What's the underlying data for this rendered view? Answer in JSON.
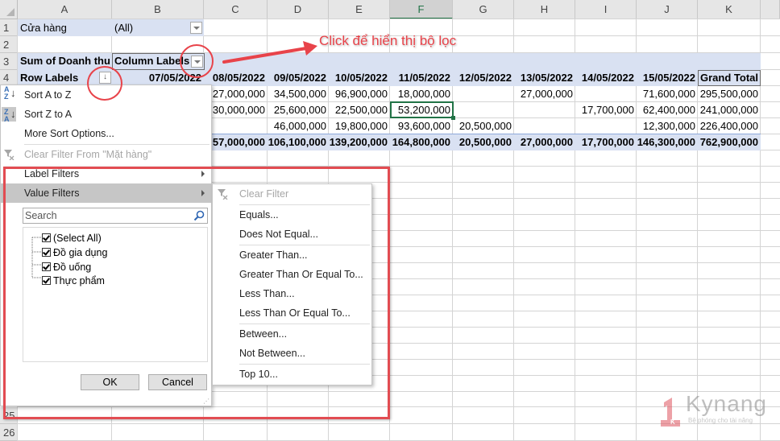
{
  "sheet": {
    "columns": [
      "A",
      "B",
      "C",
      "D",
      "E",
      "F",
      "G",
      "H",
      "I",
      "J",
      "K"
    ],
    "selected_column": "F",
    "rows_visible": [
      "1",
      "2",
      "3",
      "4",
      "25",
      "26"
    ]
  },
  "pivot": {
    "filter_label": "Cửa hàng",
    "filter_value": "(All)",
    "value_field": "Sum of Doanh thu",
    "column_labels": "Column Labels",
    "row_labels": "Row Labels",
    "date_headers": [
      "07/05/2022",
      "08/05/2022",
      "09/05/2022",
      "10/05/2022",
      "11/05/2022",
      "12/05/2022",
      "13/05/2022",
      "14/05/2022",
      "15/05/2022"
    ],
    "grand_total_header": "Grand Total",
    "rows": [
      {
        "values": [
          "",
          "27,000,000",
          "34,500,000",
          "96,900,000",
          "18,000,000",
          "",
          "27,000,000",
          "",
          "71,600,000"
        ],
        "total": "295,500,000"
      },
      {
        "values": [
          "",
          "30,000,000",
          "25,600,000",
          "22,500,000",
          "53,200,000",
          "",
          "",
          "17,700,000",
          "62,400,000"
        ],
        "total": "241,000,000"
      },
      {
        "values": [
          "",
          "",
          "46,000,000",
          "19,800,000",
          "93,600,000",
          "20,500,000",
          "",
          "",
          "12,300,000"
        ],
        "total": "226,400,000"
      }
    ],
    "grand_total_row": {
      "values": [
        "",
        "57,000,000",
        "106,100,000",
        "139,200,000",
        "164,800,000",
        "20,500,000",
        "27,000,000",
        "17,700,000",
        "146,300,000"
      ],
      "total": "762,900,000"
    },
    "active_cell": "53,200,000"
  },
  "filter_menu": {
    "items": [
      {
        "label": "Sort A to Z",
        "icon": "sort-az-icon",
        "disabled": false
      },
      {
        "label": "Sort Z to A",
        "icon": "sort-za-icon",
        "disabled": false
      },
      {
        "label": "More Sort Options...",
        "disabled": false
      },
      {
        "label": "Clear Filter From \"Mặt hàng\"",
        "icon": "clear-filter-icon",
        "disabled": true
      },
      {
        "label": "Label Filters",
        "submenu": true
      },
      {
        "label": "Value Filters",
        "submenu": true,
        "highlighted": true
      }
    ],
    "search_placeholder": "Search",
    "list": [
      {
        "label": "(Select All)",
        "checked": true
      },
      {
        "label": "Đồ gia dụng",
        "checked": true
      },
      {
        "label": "Đồ uống",
        "checked": true
      },
      {
        "label": "Thực phẩm",
        "checked": true
      }
    ],
    "ok_label": "OK",
    "cancel_label": "Cancel"
  },
  "value_filters_submenu": {
    "items": [
      {
        "label": "Clear Filter",
        "disabled": true
      },
      {
        "label": "Equals..."
      },
      {
        "label": "Does Not Equal..."
      },
      {
        "label": "Greater Than..."
      },
      {
        "label": "Greater Than Or Equal To..."
      },
      {
        "label": "Less Than..."
      },
      {
        "label": "Less Than Or Equal To..."
      },
      {
        "label": "Between..."
      },
      {
        "label": "Not Between..."
      },
      {
        "label": "Top 10..."
      }
    ]
  },
  "annotation": {
    "callout_text": "Click để hiển thị bộ lọc",
    "color": "#e8434a"
  },
  "watermark": {
    "brand": "Kynang",
    "tagline": "Bệ phóng cho tài năng"
  }
}
